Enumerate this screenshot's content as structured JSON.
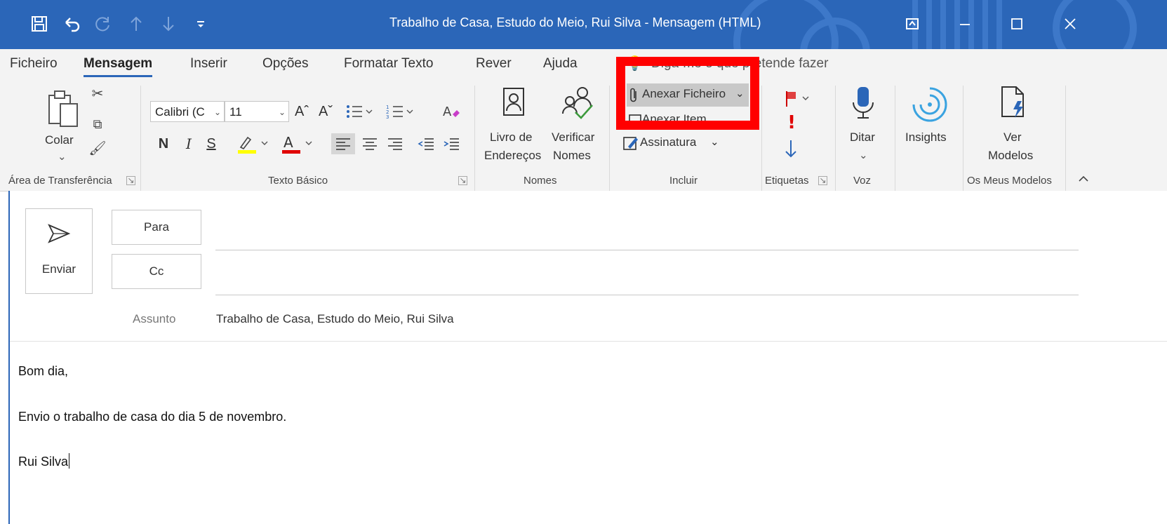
{
  "window": {
    "title": "Trabalho de Casa, Estudo do Meio, Rui Silva  -  Mensagem (HTML)",
    "quick_access": {
      "save_icon": "floppy-save-icon",
      "undo_icon": "undo-icon",
      "redo_icon": "redo-icon",
      "up_icon": "arrow-up-icon",
      "down_icon": "arrow-down-icon",
      "customize_icon": "customize-dropdown-icon"
    },
    "controls": {
      "ribbon_display_icon": "ribbon-display-options-icon",
      "minimize_icon": "minimize-icon",
      "maximize_icon": "maximize-icon",
      "close_icon": "close-icon"
    },
    "colors": {
      "accent": "#2b66b8",
      "highlight": "#ff0000"
    }
  },
  "tabs": [
    "Ficheiro",
    "Mensagem",
    "Inserir",
    "Opções",
    "Formatar Texto",
    "Rever",
    "Ajuda"
  ],
  "active_tab": "Mensagem",
  "tell_me": "Diga-me o que pretende fazer",
  "ribbon": {
    "clipboard": {
      "paste": "Colar",
      "label": "Área de Transferência"
    },
    "basic_text": {
      "font_name": "Calibri (C",
      "font_size": "11",
      "grow": "Aˆ",
      "shrink": "Aˇ",
      "bold": "N",
      "italic": "I",
      "underline": "S",
      "label": "Texto Básico"
    },
    "names": {
      "address_book_line1": "Livro de",
      "address_book_line2": "Endereços",
      "check_names_line1": "Verificar",
      "check_names_line2": "Nomes",
      "label": "Nomes"
    },
    "include": {
      "attach_file": "Anexar Ficheiro",
      "attach_item": "Anexar Item",
      "signature": "Assinatura",
      "label": "Incluir"
    },
    "tags": {
      "label": "Etiquetas",
      "importance_high": "!"
    },
    "voice": {
      "dictate": "Ditar",
      "label": "Voz"
    },
    "insights": {
      "label": "Insights"
    },
    "templates": {
      "view_line1": "Ver",
      "view_line2": "Modelos",
      "label": "Os Meus Modelos"
    }
  },
  "compose": {
    "send": "Enviar",
    "to": "Para",
    "cc": "Cc",
    "subject_label": "Assunto",
    "subject": "Trabalho de Casa, Estudo do Meio, Rui Silva",
    "body": {
      "line1": "Bom dia,",
      "line2": "Envio o trabalho de casa do dia 5 de novembro.",
      "line3": "Rui Silva"
    }
  }
}
